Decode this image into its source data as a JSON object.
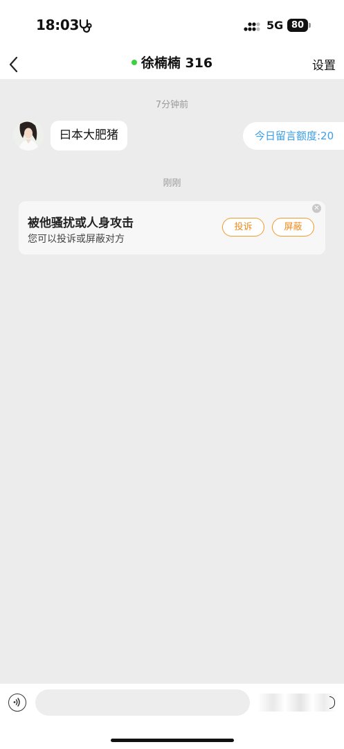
{
  "status_bar": {
    "time": "18:03",
    "network": "5G",
    "battery": "80",
    "health_icon": "stethoscope-icon",
    "signal_icon": "signal-icon"
  },
  "header": {
    "back_icon": "chevron-left-icon",
    "title": "徐楠楠 316",
    "online_color": "#3fcf3f",
    "settings_label": "设置"
  },
  "chat": {
    "timestamp_1": "7分钟前",
    "incoming_message": "曰本大肥猪",
    "quota_label": "今日留言额度:20",
    "timestamp_2": "刚刚",
    "report_card": {
      "title": "被他骚扰或人身攻击",
      "subtitle": "您可以投诉或屏蔽对方",
      "complain_label": "投诉",
      "block_label": "屏蔽",
      "close_icon": "close-icon",
      "accent_color": "#ef8a1a"
    }
  },
  "input_bar": {
    "voice_icon": "voice-icon",
    "placeholder": ""
  },
  "colors": {
    "background": "#ececec",
    "quota_text": "#3a9ee8"
  }
}
